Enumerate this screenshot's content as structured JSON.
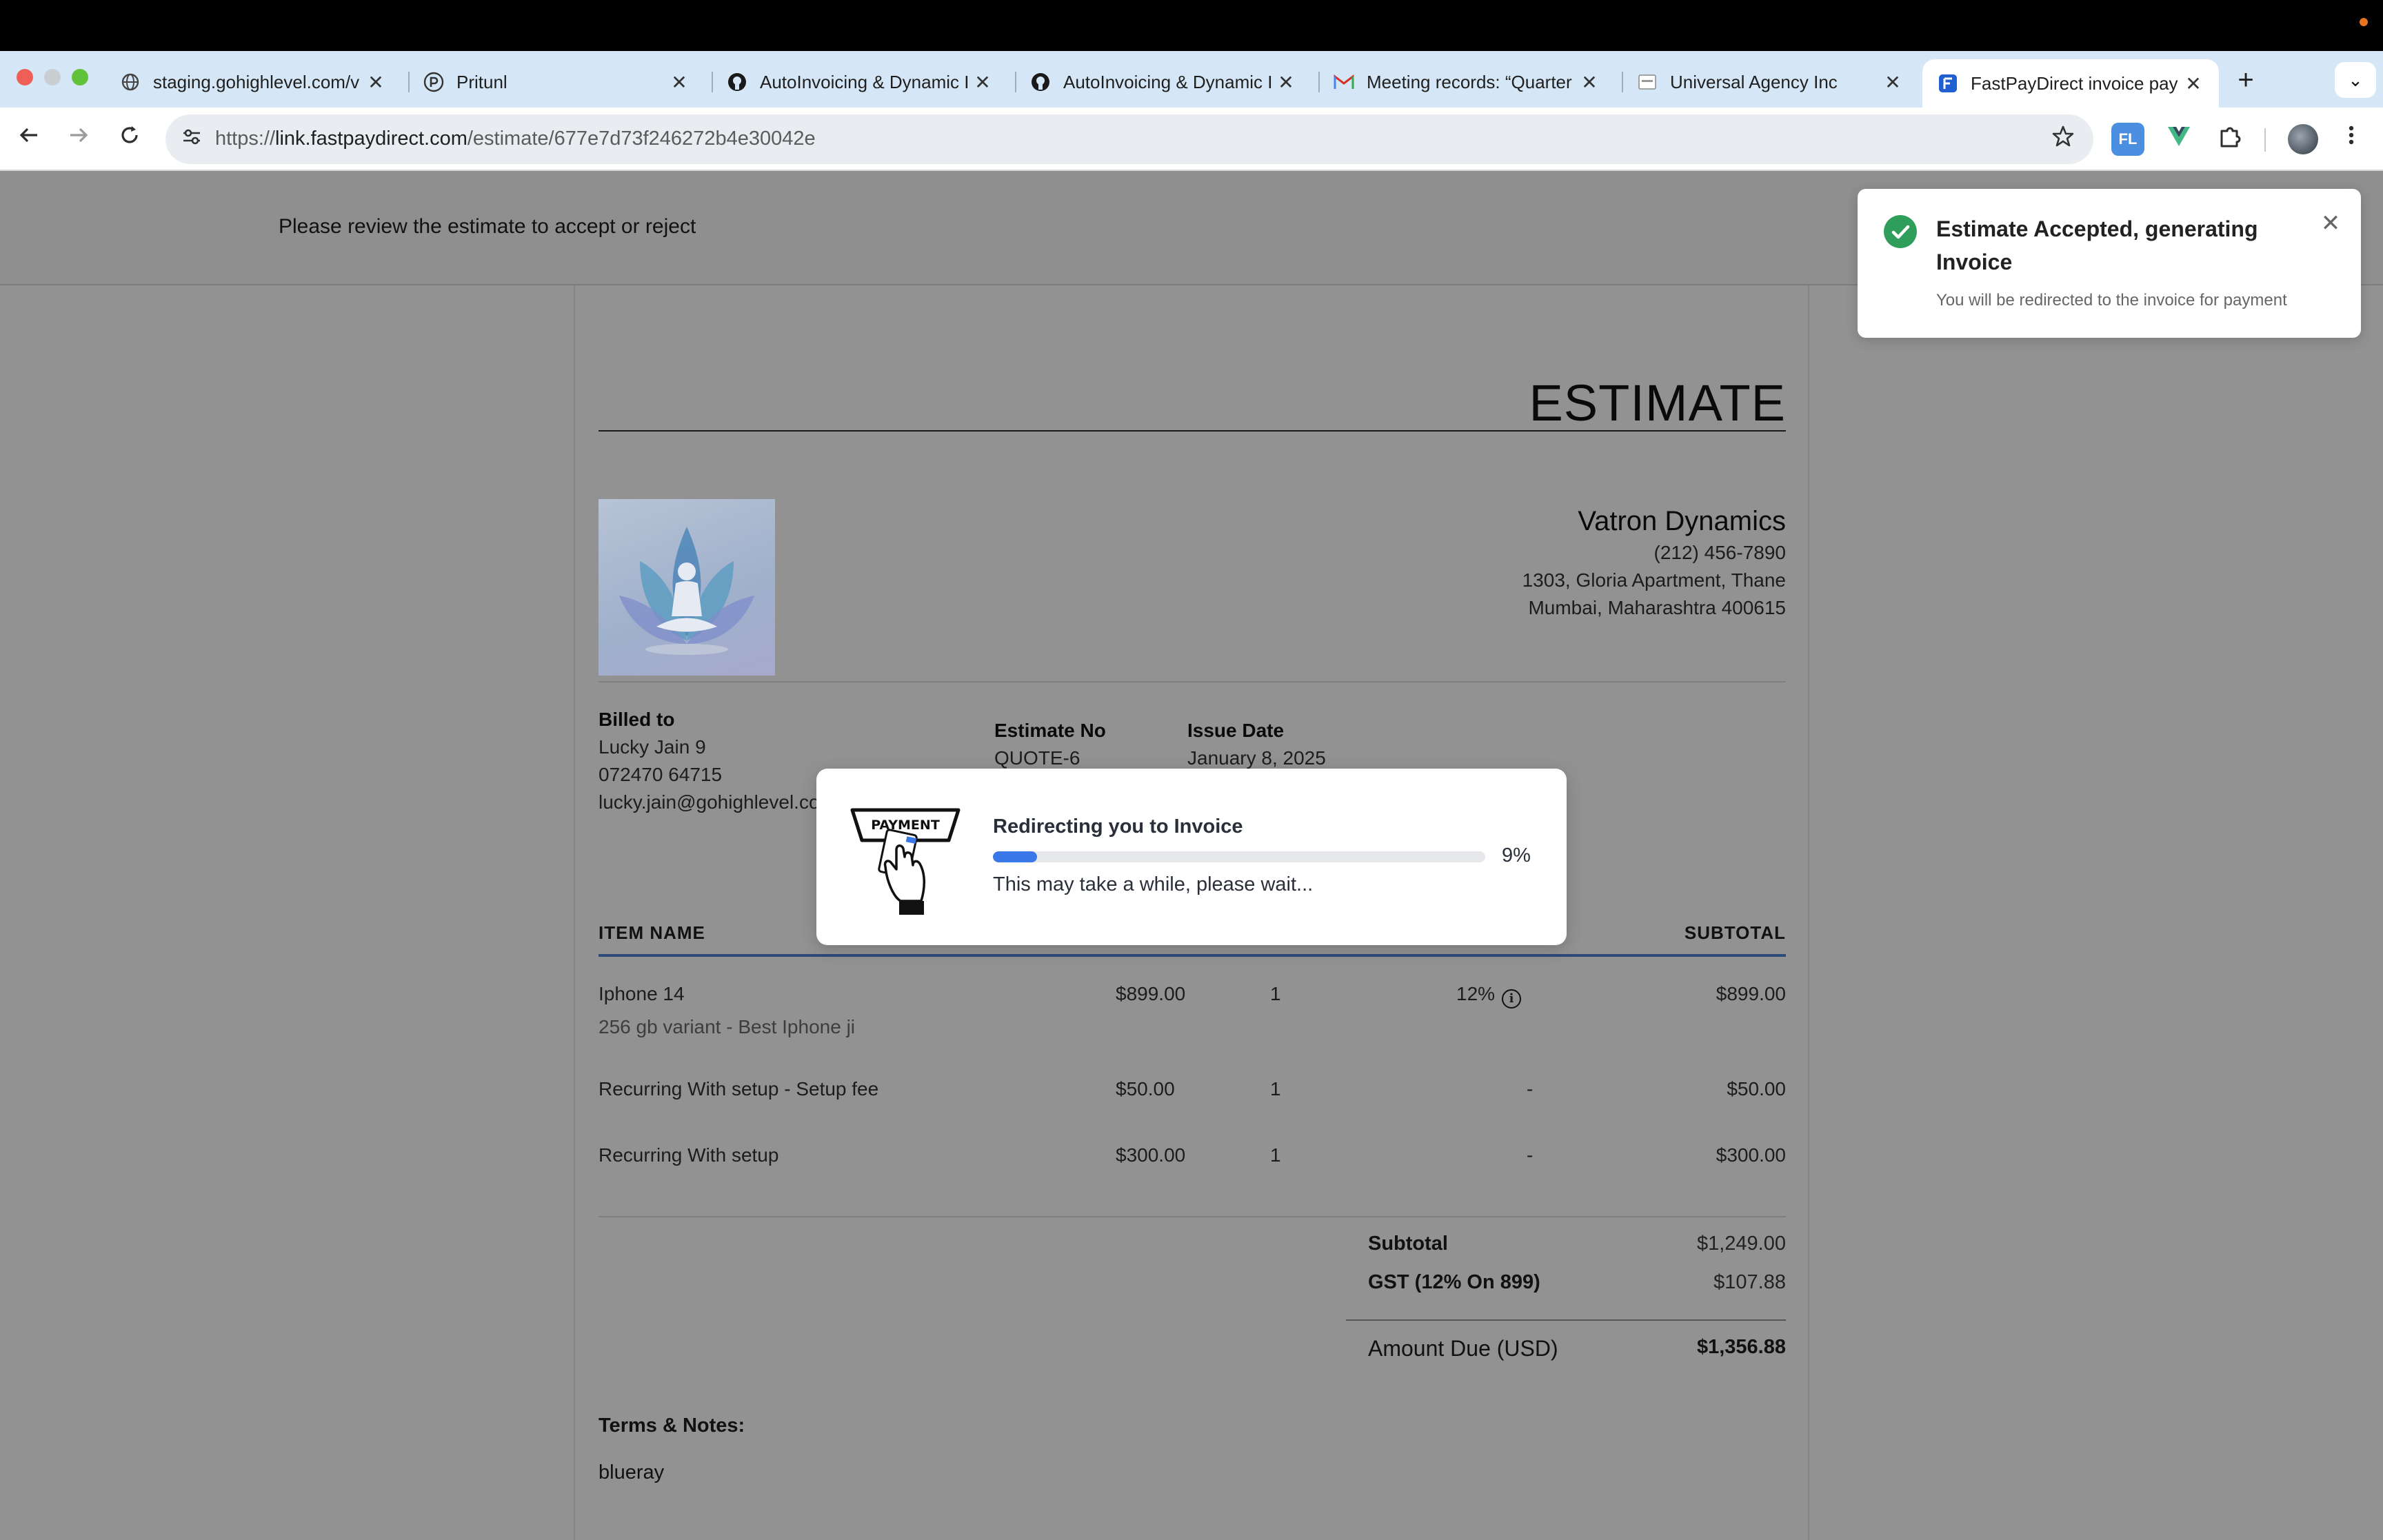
{
  "browser": {
    "tabs": [
      {
        "label": "staging.gohighlevel.com/v",
        "icon": "globe-icon"
      },
      {
        "label": "Pritunl",
        "icon": "pritunl-icon"
      },
      {
        "label": "AutoInvoicing & Dynamic I",
        "icon": "github-icon"
      },
      {
        "label": "AutoInvoicing & Dynamic I",
        "icon": "github-icon"
      },
      {
        "label": "Meeting records: “Quarter",
        "icon": "gmail-icon"
      },
      {
        "label": "Universal Agency Inc",
        "icon": "page-icon"
      },
      {
        "label": "FastPayDirect invoice pay",
        "icon": "fastpay-icon"
      }
    ],
    "tab_close_glyph": "✕",
    "new_tab_glyph": "+",
    "tab_menu_glyph": "⌄",
    "url_scheme": "https://",
    "url_host": "link.fastpaydirect.com",
    "url_path": "/estimate/677e7d73f246272b4e30042e",
    "extension_fl_label": "FL",
    "extension_v_label": "V"
  },
  "page": {
    "header_text": "Please review the estimate to accept or reject"
  },
  "estimate": {
    "title": "ESTIMATE",
    "company": {
      "name": "Vatron Dynamics",
      "phone": "(212) 456-7890",
      "address_line1": "1303, Gloria Apartment, Thane",
      "address_line2": "Mumbai, Maharashtra 400615"
    },
    "billed_to": {
      "label": "Billed to",
      "name": "Lucky Jain 9",
      "phone": "072470 64715",
      "email": "lucky.jain@gohighlevel.co"
    },
    "estimate_no_label": "Estimate No",
    "estimate_no": "QUOTE-6",
    "issue_date_label": "Issue Date",
    "issue_date": "January 8, 2025",
    "columns": {
      "item_name": "ITEM NAME",
      "subtotal": "SUBTOTAL"
    },
    "items": [
      {
        "name": "Iphone 14",
        "description": "256 gb variant - Best Iphone ji",
        "price": "$899.00",
        "qty": "1",
        "tax": "12%",
        "subtotal": "$899.00"
      },
      {
        "name": "Recurring With setup - Setup fee",
        "description": "",
        "price": "$50.00",
        "qty": "1",
        "tax": "-",
        "subtotal": "$50.00"
      },
      {
        "name": "Recurring With setup",
        "description": "",
        "price": "$300.00",
        "qty": "1",
        "tax": "-",
        "subtotal": "$300.00"
      }
    ],
    "totals": {
      "subtotal_label": "Subtotal",
      "subtotal_value": "$1,249.00",
      "tax_label": "GST (12% On 899)",
      "tax_value": "$107.88",
      "amount_due_label": "Amount Due (USD)",
      "amount_due_value": "$1,356.88"
    },
    "terms_label": "Terms & Notes:",
    "terms_text": "blueray"
  },
  "modal": {
    "illustration_label": "PAYMENT",
    "title": "Redirecting you to Invoice",
    "progress": 0.09,
    "progress_text": "9%",
    "subtitle": "This may take a while, please wait..."
  },
  "toast": {
    "title": "Estimate Accepted, generating Invoice",
    "subtitle": "You will be redirected to the invoice for payment",
    "close_glyph": "✕"
  },
  "colors": {
    "progress_fill": "#3b78e7",
    "success": "#2f9e5b",
    "overlay_gray": "#929292"
  }
}
